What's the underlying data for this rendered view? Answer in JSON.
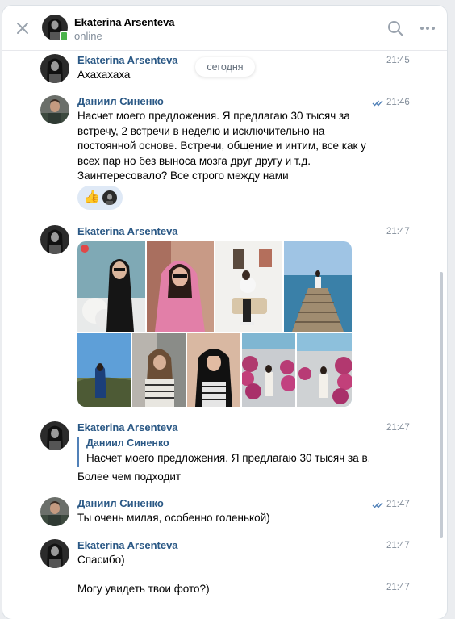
{
  "header": {
    "name": "Ekaterina Arsenteva",
    "status": "online"
  },
  "date_divider": "сегодня",
  "messages": [
    {
      "author": "Ekaterina Arsenteva",
      "time": "21:45",
      "text": "Ахахахаха"
    },
    {
      "author": "Даниил Синенко",
      "time": "21:46",
      "read": true,
      "lines": [
        "Насчет моего предложения. Я предлагаю 30 тысяч за",
        "встречу, 2 встречи в неделю и исключительно на",
        "постоянной основе. Встречи, общение и интим, все как у",
        "всех пар но без выноса мозга друг другу и т.д.",
        "Заинтересовало? Все строго между нами"
      ],
      "reaction": {
        "emoji": "👍"
      }
    },
    {
      "author": "Ekaterina Arsenteva",
      "time": "21:47",
      "photos_count": 9
    },
    {
      "author": "Ekaterina Arsenteva",
      "time": "21:47",
      "reply": {
        "author": "Даниил Синенко",
        "text": "Насчет моего предложения. Я предлагаю 30 тысяч за в..."
      },
      "text": "Более чем подходит"
    },
    {
      "author": "Даниил Синенко",
      "time": "21:47",
      "read": true,
      "text": "Ты очень милая, особенно голенькой)"
    },
    {
      "author": "Ekaterina Arsenteva",
      "time": "21:47",
      "text": "Спасибо)"
    },
    {
      "time": "21:47",
      "text": "Могу увидеть твои фото?)"
    }
  ],
  "icons": {
    "close": "close-icon",
    "search": "search-icon",
    "more": "more-horizontal-icon",
    "read": "double-check-icon"
  },
  "colors": {
    "link": "#2a5885",
    "muted": "#818c99",
    "online": "#4bb34b",
    "reaction_bg": "#dfe9f6",
    "read_check": "#5181b8"
  }
}
